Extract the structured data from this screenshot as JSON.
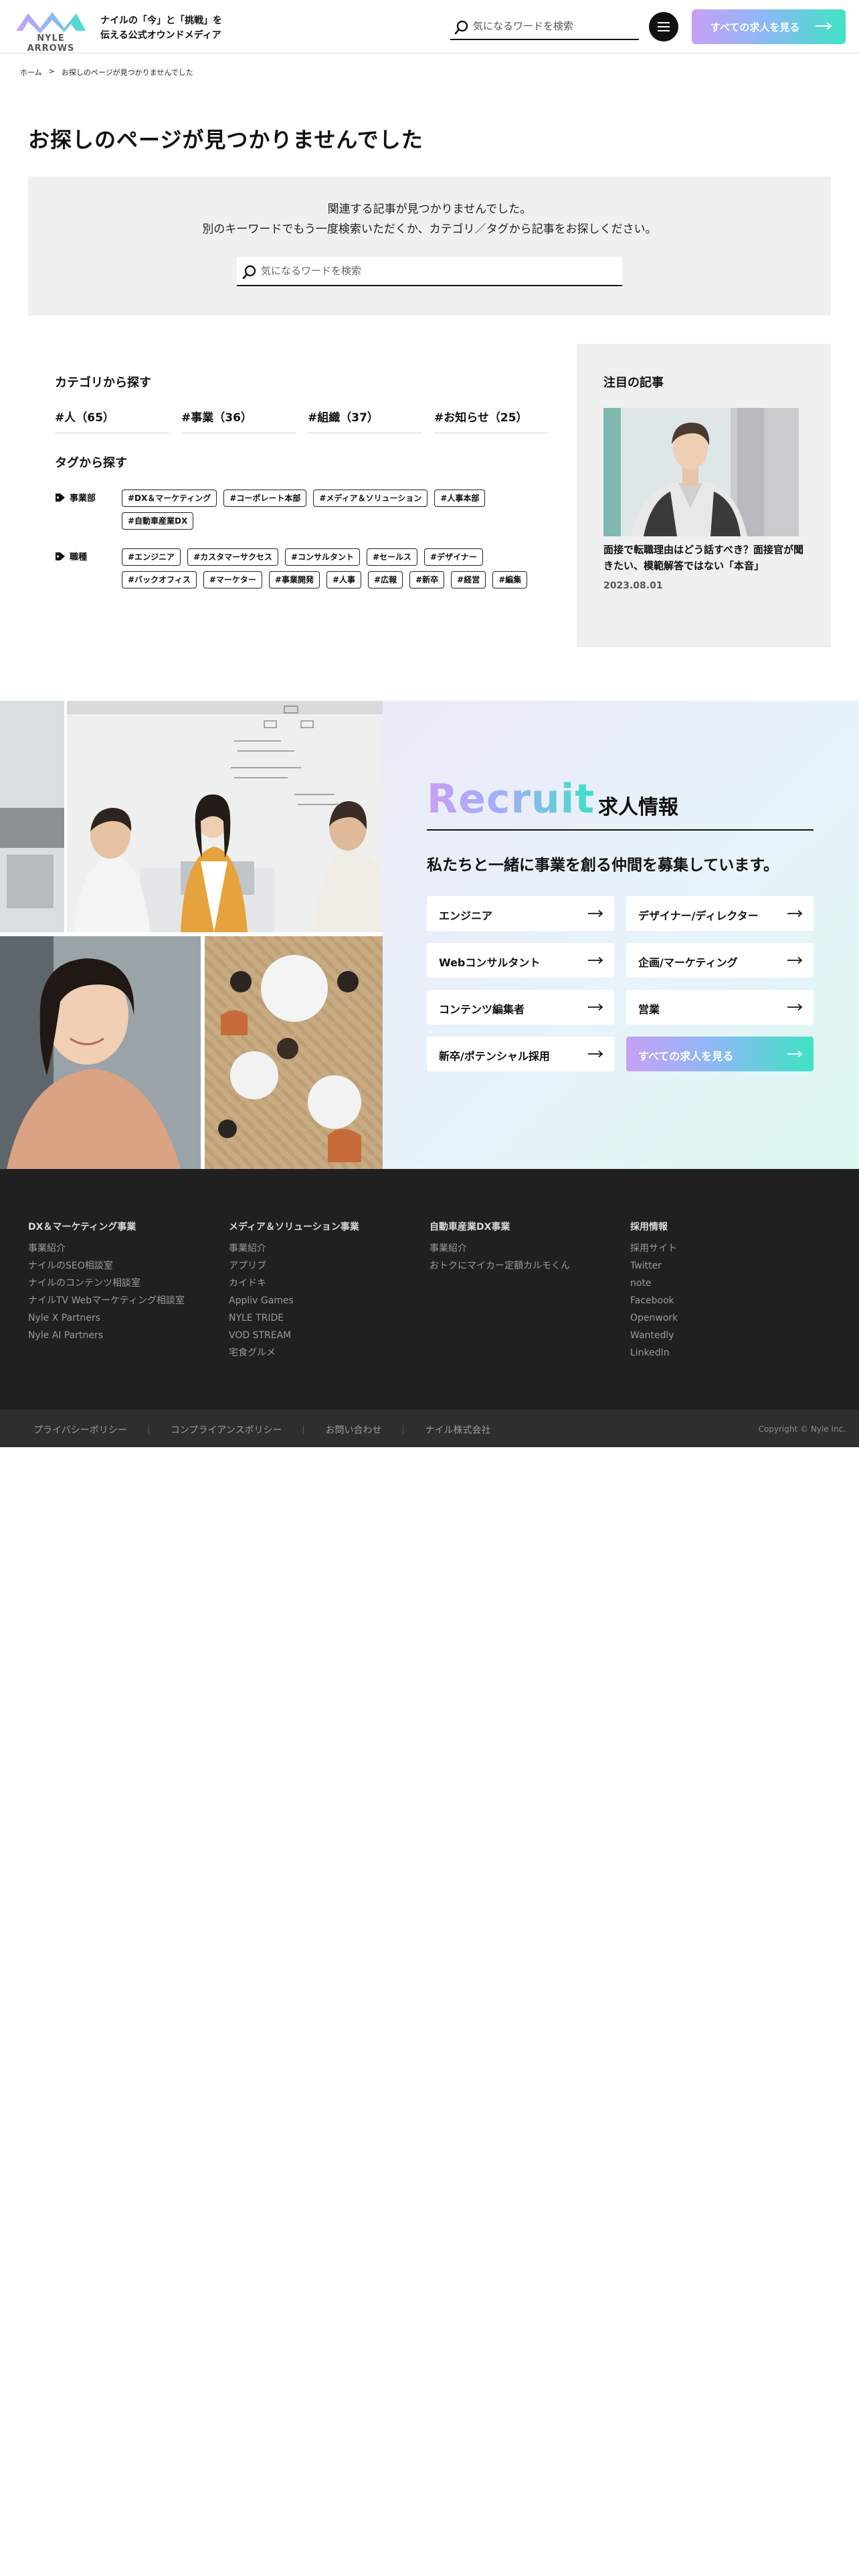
{
  "header": {
    "logo_text": "NYLE ARROWS",
    "tagline_line1": "ナイルの「今」と「挑戦」を",
    "tagline_line2": "伝える公式オウンドメディア",
    "search_placeholder": "気になるワードを検索",
    "all_jobs_button": "すべての求人を見る"
  },
  "breadcrumb": {
    "home": "ホーム",
    "separator": ">",
    "current": "お探しのページが見つかりませんでした"
  },
  "page_title": "お探しのページが見つかりませんでした",
  "not_found": {
    "message_line1": "関連する記事が見つかりませんでした。",
    "message_line2": "別のキーワードでもう一度検索いただくか、カテゴリ／タグから記事をお探しください。",
    "search_placeholder": "気になるワードを検索"
  },
  "categories": {
    "heading": "カテゴリから探す",
    "items": [
      {
        "label": "#人（65）"
      },
      {
        "label": "#事業（36）"
      },
      {
        "label": "#組織（37）"
      },
      {
        "label": "#お知らせ（25）"
      }
    ]
  },
  "tags": {
    "heading": "タグから探す",
    "groups": [
      {
        "label": "事業部",
        "tags": [
          "#DX＆マーケティング",
          "#コーポレート本部",
          "#メディア＆ソリューション",
          "#人事本部",
          "#自動車産業DX"
        ]
      },
      {
        "label": "職種",
        "tags": [
          "#エンジニア",
          "#カスタマーサクセス",
          "#コンサルタント",
          "#セールス",
          "#デザイナー",
          "#バックオフィス",
          "#マーケター",
          "#事業開発",
          "#人事",
          "#広報",
          "#新卒",
          "#経営",
          "#編集"
        ]
      }
    ]
  },
  "featured": {
    "heading": "注目の記事",
    "title": "面接で転職理由はどう話すべき？面接官が聞きたい、模範解答ではない「本音」",
    "date": "2023.08.01"
  },
  "recruit": {
    "word": "Recruit",
    "title_jp": "求人情報",
    "lead": "私たちと一緒に事業を創る仲間を募集しています。",
    "buttons": [
      {
        "label": "エンジニア"
      },
      {
        "label": "デザイナー/ディレクター"
      },
      {
        "label": "Webコンサルタント"
      },
      {
        "label": "企画/マーケティング"
      },
      {
        "label": "コンテンツ編集者"
      },
      {
        "label": "営業"
      },
      {
        "label": "新卒/ポテンシャル採用"
      },
      {
        "label": "すべての求人を見る"
      }
    ]
  },
  "footer": {
    "columns": [
      {
        "heading": "DX＆マーケティング事業",
        "links": [
          "事業紹介",
          "ナイルのSEO相談室",
          "ナイルのコンテンツ相談室",
          "ナイルTV Webマーケティング相談室",
          "Nyle X Partners",
          "Nyle AI Partners"
        ]
      },
      {
        "heading": "メディア＆ソリューション事業",
        "links": [
          "事業紹介",
          "アプリブ",
          "カイドキ",
          "Appliv Games",
          "NYLE TRIDE",
          "VOD STREAM",
          "宅食グルメ"
        ]
      },
      {
        "heading": "自動車産業DX事業",
        "links": [
          "事業紹介",
          "おトクにマイカー定額カルモくん"
        ]
      },
      {
        "heading": "採用情報",
        "links": [
          "採用サイト",
          "Twitter",
          "note",
          "Facebook",
          "Openwork",
          "Wantedly",
          "LinkedIn"
        ]
      }
    ],
    "bottom_links": [
      "プライバシーポリシー",
      "コンプライアンスポリシー",
      "お問い合わせ",
      "ナイル株式会社"
    ],
    "copyright": "Copyright © Nyle Inc."
  },
  "colors": {
    "accent_gradient_start": "#c7a0f5",
    "accent_gradient_end": "#3fe3c4",
    "footer_bg": "#202020"
  }
}
